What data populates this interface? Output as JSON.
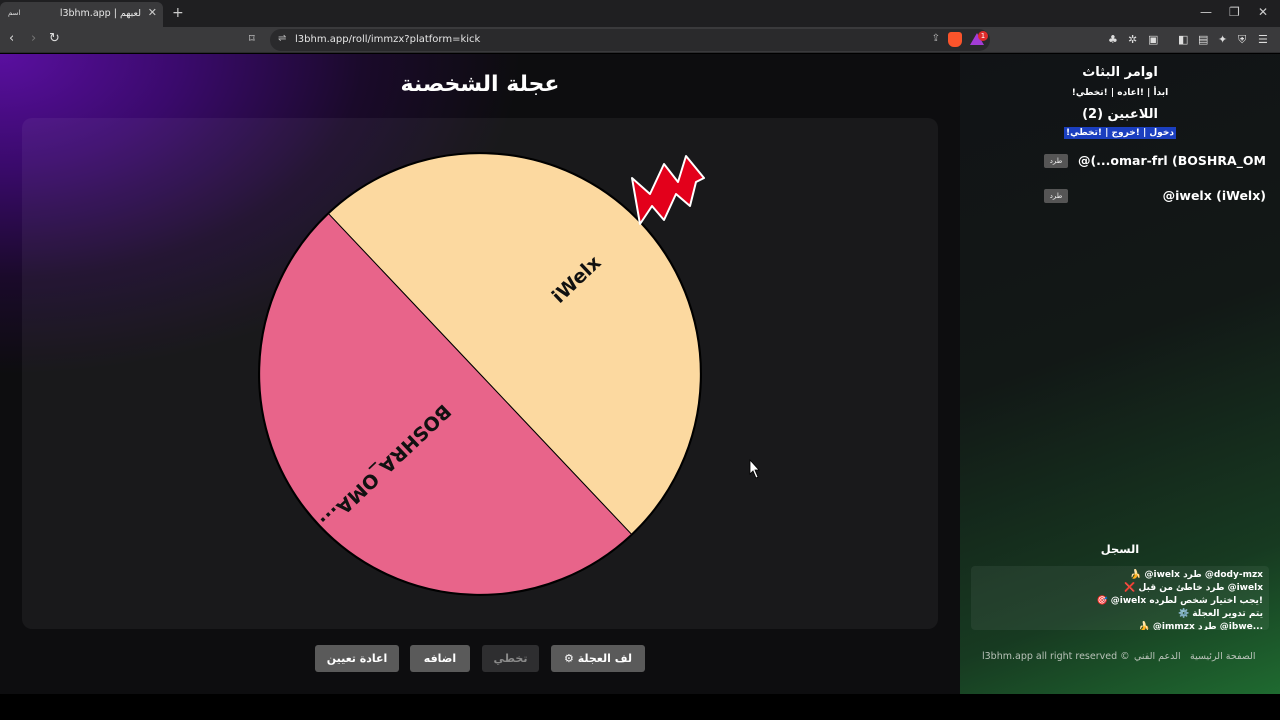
{
  "browser": {
    "tab_favicon_text": "اسم",
    "tab_title": "l3bhm.app | لعبهم",
    "url": "l3bhm.app/roll/immzx?platform=kick",
    "rewards_badge": "1"
  },
  "main": {
    "title": "عجلة الشخصنة",
    "wheel": {
      "segments": [
        {
          "label": "iWelx",
          "color": "#fcd9a0"
        },
        {
          "label": "BOSHRA_OMA...",
          "color": "#e8648a"
        }
      ],
      "pointer_color": "#e3001b"
    },
    "buttons": {
      "spin": "لف العجلة",
      "skip": "تخطي",
      "add": "اضافه",
      "reset": "اعادة تعيين"
    }
  },
  "sidebar": {
    "streamer_commands_title": "اوامر البثاث",
    "streamer_commands": "!ابدأ | !اعاده | !تخطي",
    "players_title": "اللاعبين (2)",
    "player_commands": "!دخول | !خروج | !تخطي",
    "players": [
      {
        "name": "@(...omar-frl (BOSHRA_OM",
        "kick_label": "طرد"
      },
      {
        "name": "@iwelx (iWelx)",
        "kick_label": "طرد"
      }
    ],
    "log_title": "السجل",
    "log": [
      "🍌 @iwelx طرد @dody-mzx",
      "❌ طرد خاطئ من قبل @iwelx",
      "🎯 @iwelx يجب اختيار شخص لطرده!",
      "⚙️ يتم تدوير العجلة",
      "🍌 @immzx طرد @ibwe..."
    ],
    "footer": {
      "home": "الصفحة الرئيسية",
      "support": "الدعم الفني",
      "copyright": "l3bhm.app all right reserved ©"
    }
  }
}
